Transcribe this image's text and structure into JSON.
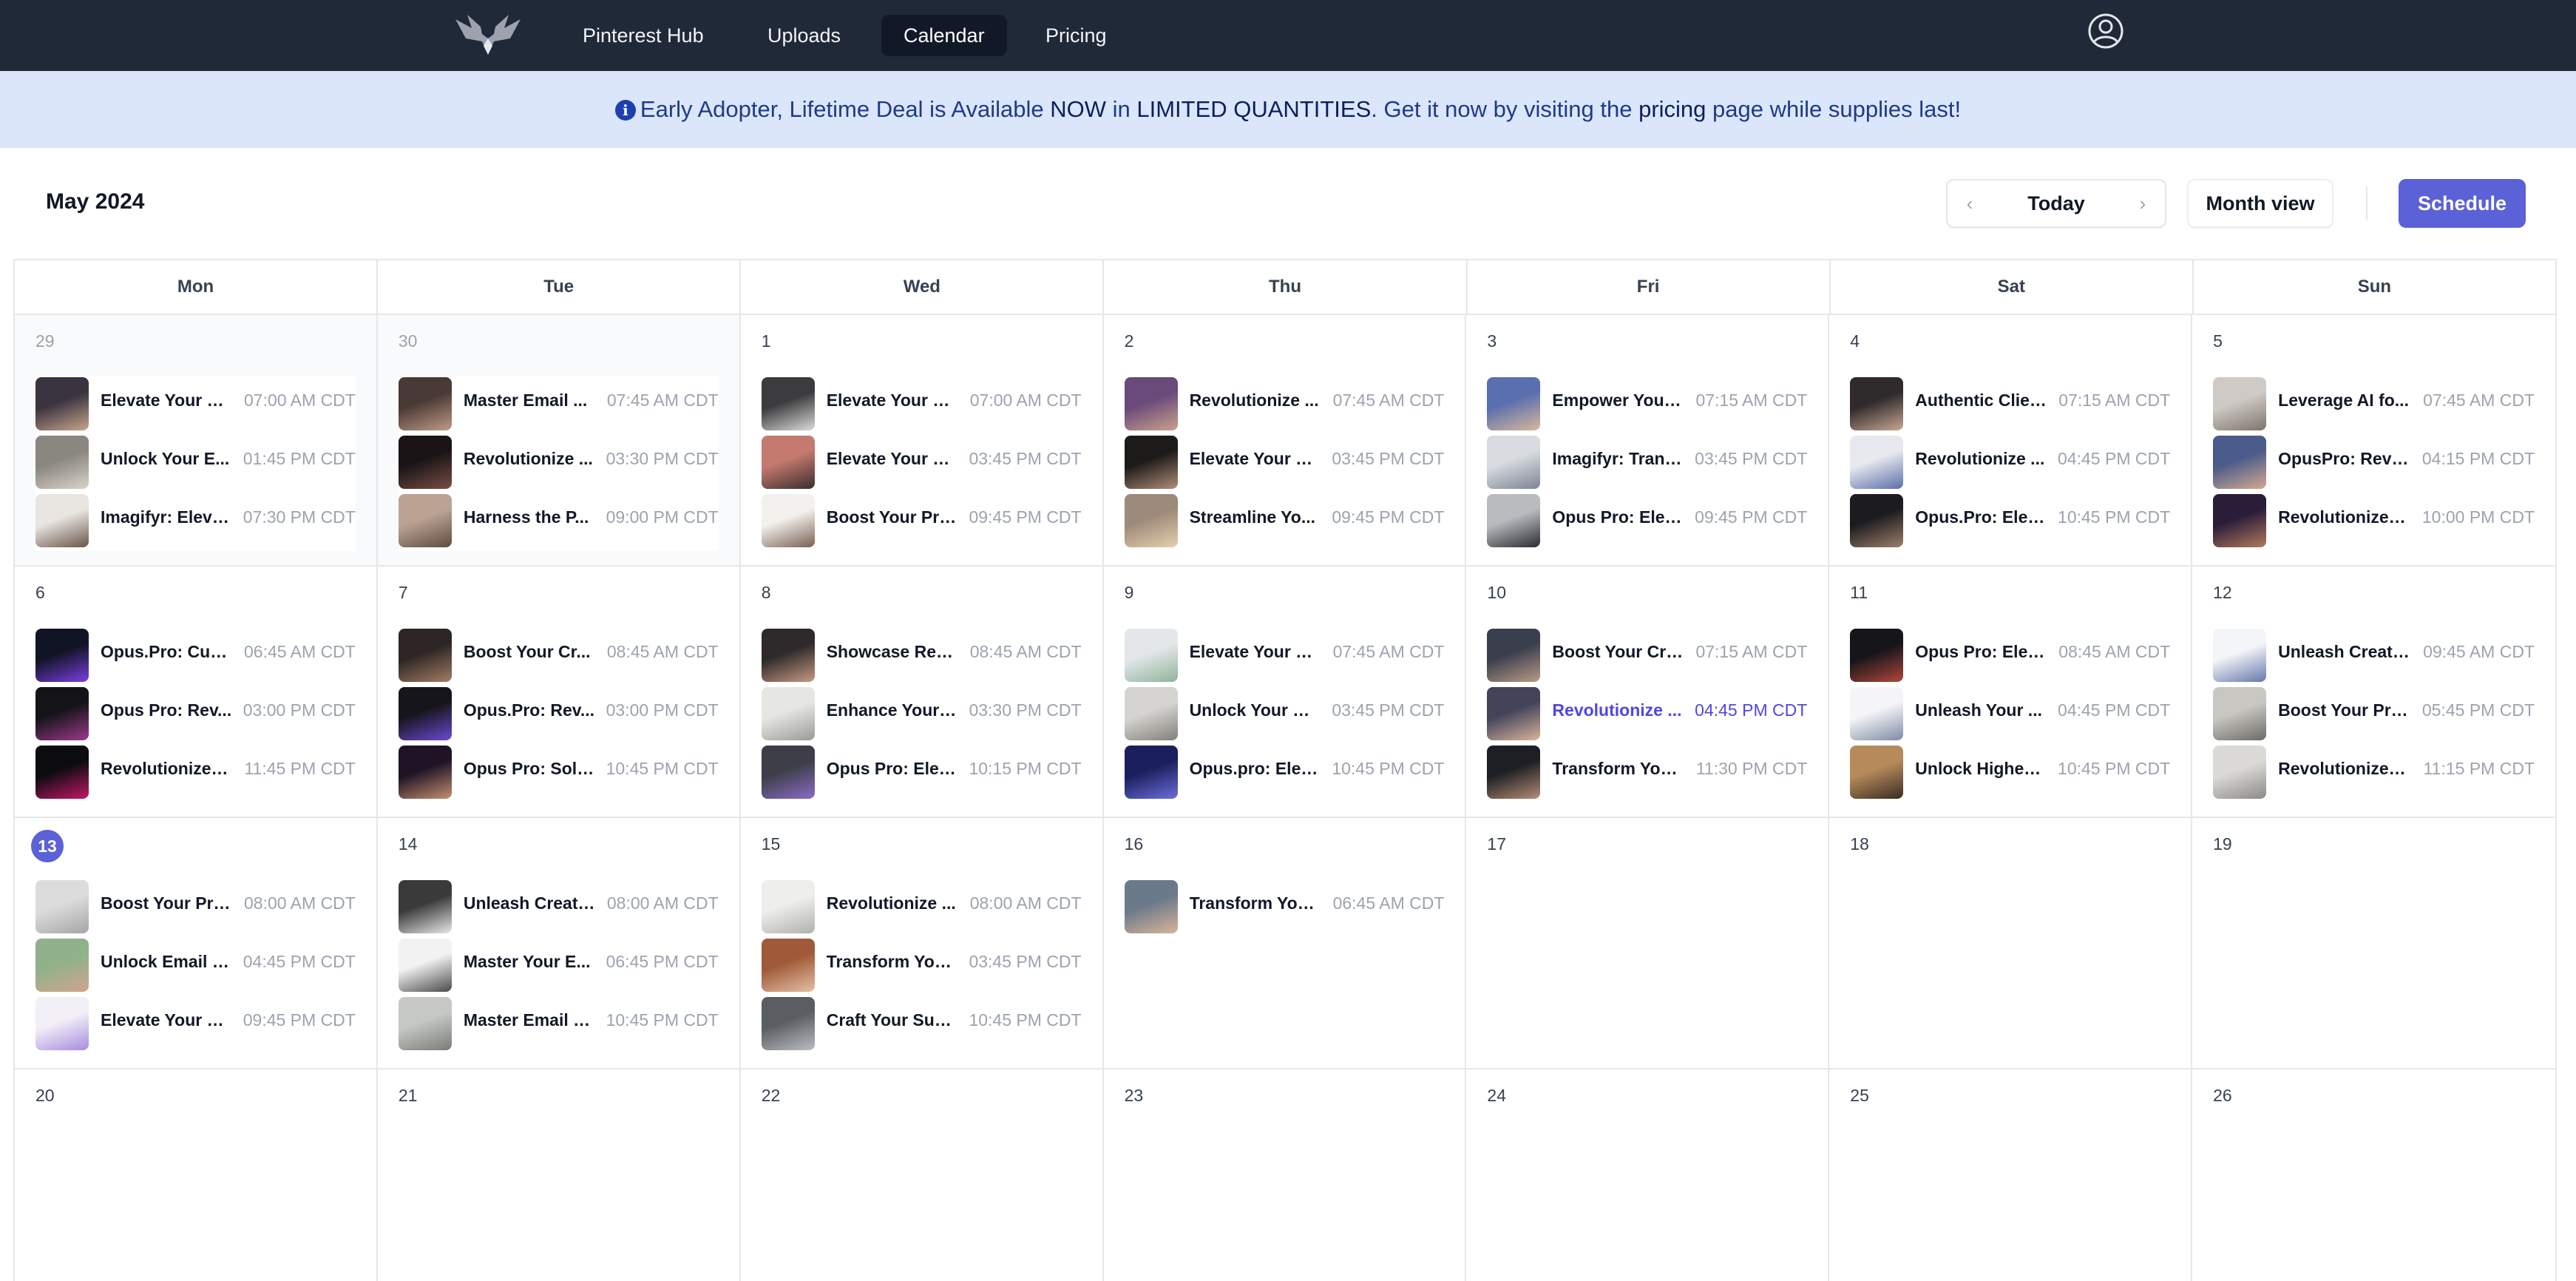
{
  "nav": {
    "links": [
      "Pinterest Hub",
      "Uploads",
      "Calendar",
      "Pricing"
    ],
    "active": "Calendar"
  },
  "banner": {
    "part1": "Early Adopter, Lifetime Deal is Available ",
    "now": "NOW",
    "part2": " in ",
    "limited": "LIMITED QUANTITIES",
    "part3": ". Get it now by visiting the ",
    "pricing": "pricing",
    "part4": " page while supplies last!"
  },
  "header": {
    "month": "May 2024",
    "today_label": "Today",
    "view_label": "Month view",
    "schedule_label": "Schedule"
  },
  "weekdays": [
    "Mon",
    "Tue",
    "Wed",
    "Thu",
    "Fri",
    "Sat",
    "Sun"
  ],
  "colors": {
    "accent": "#5b61d6",
    "nav_bg": "#1f2937",
    "banner_bg": "#dbe6fb",
    "highlight_event": "#4f46e5"
  },
  "days": [
    {
      "num": "29",
      "prev": true,
      "events": [
        {
          "title": "Elevate Your B...",
          "time": "07:00 AM CDT",
          "thumb": [
            "#3a3340",
            "#c8a58a"
          ]
        },
        {
          "title": "Unlock Your E...",
          "time": "01:45 PM CDT",
          "thumb": [
            "#8a8680",
            "#d9d4cc"
          ]
        },
        {
          "title": "Imagifyr: Eleva...",
          "time": "07:30 PM CDT",
          "thumb": [
            "#e9e6e2",
            "#6b5347"
          ]
        }
      ]
    },
    {
      "num": "30",
      "prev": true,
      "events": [
        {
          "title": "Master Email ...",
          "time": "07:45 AM CDT",
          "thumb": [
            "#4a3a36",
            "#c19a86"
          ]
        },
        {
          "title": "Revolutionize ...",
          "time": "03:30 PM CDT",
          "thumb": [
            "#1a1416",
            "#7a4d46"
          ]
        },
        {
          "title": "Harness the P...",
          "time": "09:00 PM CDT",
          "thumb": [
            "#bba394",
            "#5e4b40"
          ]
        }
      ]
    },
    {
      "num": "1",
      "events": [
        {
          "title": "Elevate Your E...",
          "time": "07:00 AM CDT",
          "thumb": [
            "#3c3c3e",
            "#dcdcdc"
          ]
        },
        {
          "title": "Elevate Your E...",
          "time": "03:45 PM CDT",
          "thumb": [
            "#c47a6e",
            "#3b2c2c"
          ]
        },
        {
          "title": "Boost Your Pro...",
          "time": "09:45 PM CDT",
          "thumb": [
            "#f3f1ee",
            "#7a5f52"
          ]
        }
      ]
    },
    {
      "num": "2",
      "events": [
        {
          "title": "Revolutionize ...",
          "time": "07:45 AM CDT",
          "thumb": [
            "#6a4a7a",
            "#caa18b"
          ]
        },
        {
          "title": "Elevate Your B...",
          "time": "03:45 PM CDT",
          "thumb": [
            "#1d1a1a",
            "#b08e78"
          ]
        },
        {
          "title": "Streamline Yo...",
          "time": "09:45 PM CDT",
          "thumb": [
            "#9d8a7a",
            "#e6cfae"
          ]
        }
      ]
    },
    {
      "num": "3",
      "events": [
        {
          "title": "Empower Your ...",
          "time": "07:15 AM CDT",
          "thumb": [
            "#5a6fb0",
            "#d9b79a"
          ]
        },
        {
          "title": "Imagifyr: Trans...",
          "time": "03:45 PM CDT",
          "thumb": [
            "#d8dbe0",
            "#7b8494"
          ]
        },
        {
          "title": "Opus Pro: Elev...",
          "time": "09:45 PM CDT",
          "thumb": [
            "#b9bbbf",
            "#2a2c33"
          ]
        }
      ]
    },
    {
      "num": "4",
      "events": [
        {
          "title": "Authentic Clien...",
          "time": "07:15 AM CDT",
          "thumb": [
            "#2f2a2c",
            "#c9a891"
          ]
        },
        {
          "title": "Revolutionize ...",
          "time": "04:45 PM CDT",
          "thumb": [
            "#e8e9ee",
            "#5a6ea8"
          ]
        },
        {
          "title": "Opus.Pro: Elev...",
          "time": "10:45 PM CDT",
          "thumb": [
            "#1c1c20",
            "#a07e6a"
          ]
        }
      ]
    },
    {
      "num": "5",
      "events": [
        {
          "title": "Leverage AI fo...",
          "time": "07:45 AM CDT",
          "thumb": [
            "#cfcac5",
            "#7d746b"
          ]
        },
        {
          "title": "OpusPro: Revol...",
          "time": "04:15 PM CDT",
          "thumb": [
            "#4a5b8c",
            "#d3a98e"
          ]
        },
        {
          "title": "Revolutionize Y...",
          "time": "10:00 PM CDT",
          "thumb": [
            "#2a1d3a",
            "#b27a5c"
          ]
        }
      ]
    },
    {
      "num": "6",
      "events": [
        {
          "title": "Opus.Pro: Cutt...",
          "time": "06:45 AM CDT",
          "thumb": [
            "#101425",
            "#7a3ee0"
          ]
        },
        {
          "title": "Opus Pro: Rev...",
          "time": "03:00 PM CDT",
          "thumb": [
            "#141418",
            "#9b3b8a"
          ]
        },
        {
          "title": "Revolutionize Y...",
          "time": "11:45 PM CDT",
          "thumb": [
            "#0c0c0f",
            "#c2186a"
          ]
        }
      ]
    },
    {
      "num": "7",
      "events": [
        {
          "title": "Boost Your Cr...",
          "time": "08:45 AM CDT",
          "thumb": [
            "#2d2624",
            "#a47c66"
          ]
        },
        {
          "title": "Opus.Pro: Rev...",
          "time": "03:00 PM CDT",
          "thumb": [
            "#17151c",
            "#6c4ad4"
          ]
        },
        {
          "title": "Opus Pro: Solu...",
          "time": "10:45 PM CDT",
          "thumb": [
            "#1e1426",
            "#c59070"
          ]
        }
      ]
    },
    {
      "num": "8",
      "events": [
        {
          "title": "Showcase Rea...",
          "time": "08:45 AM CDT",
          "thumb": [
            "#2e2a2b",
            "#c89a82"
          ]
        },
        {
          "title": "Enhance Your ...",
          "time": "03:30 PM CDT",
          "thumb": [
            "#e6e6e3",
            "#9a9a95"
          ]
        },
        {
          "title": "Opus Pro: Elev...",
          "time": "10:15 PM CDT",
          "thumb": [
            "#3d3e47",
            "#8a6cc8"
          ]
        }
      ]
    },
    {
      "num": "9",
      "events": [
        {
          "title": "Elevate Your B...",
          "time": "07:45 AM CDT",
          "thumb": [
            "#e4e7ea",
            "#8fb39a"
          ]
        },
        {
          "title": "Unlock Your W...",
          "time": "03:45 PM CDT",
          "thumb": [
            "#d5d4d0",
            "#83807a"
          ]
        },
        {
          "title": "Opus.pro: Elev...",
          "time": "10:45 PM CDT",
          "thumb": [
            "#1b1f5e",
            "#6b6ed8"
          ]
        }
      ]
    },
    {
      "num": "10",
      "events": [
        {
          "title": "Boost Your Cre...",
          "time": "07:15 AM CDT",
          "thumb": [
            "#3a3f4e",
            "#b99a86"
          ]
        },
        {
          "title": "Revolutionize ...",
          "time": "04:45 PM CDT",
          "highlight": true,
          "thumb": [
            "#43445a",
            "#d8b49b"
          ]
        },
        {
          "title": "Transform Your...",
          "time": "11:30 PM CDT",
          "thumb": [
            "#1e1f24",
            "#b58d76"
          ]
        }
      ]
    },
    {
      "num": "11",
      "events": [
        {
          "title": "Opus Pro: Elev...",
          "time": "08:45 AM CDT",
          "thumb": [
            "#15151a",
            "#b0463a"
          ]
        },
        {
          "title": "Unleash Your ...",
          "time": "04:45 PM CDT",
          "thumb": [
            "#f5f5f7",
            "#7f8aa6"
          ]
        },
        {
          "title": "Unlock Higher ...",
          "time": "10:45 PM CDT",
          "thumb": [
            "#b68a5a",
            "#3a2c22"
          ]
        }
      ]
    },
    {
      "num": "12",
      "events": [
        {
          "title": "Unleash Creati...",
          "time": "09:45 AM CDT",
          "thumb": [
            "#f4f5f8",
            "#6677aa"
          ]
        },
        {
          "title": "Boost Your Pro...",
          "time": "05:45 PM CDT",
          "thumb": [
            "#c9c7c2",
            "#6c6a66"
          ]
        },
        {
          "title": "Revolutionize Y...",
          "time": "11:15 PM CDT",
          "thumb": [
            "#dcdad6",
            "#8c8a86"
          ]
        }
      ]
    },
    {
      "num": "13",
      "today": true,
      "events": [
        {
          "title": "Boost Your Pro...",
          "time": "08:00 AM CDT",
          "thumb": [
            "#dcdcdc",
            "#a6a6a6"
          ]
        },
        {
          "title": "Unlock Email S...",
          "time": "04:45 PM CDT",
          "thumb": [
            "#8fb28a",
            "#cfa58e"
          ]
        },
        {
          "title": "Elevate Your E...",
          "time": "09:45 PM CDT",
          "thumb": [
            "#f2f0f6",
            "#a88be0"
          ]
        }
      ]
    },
    {
      "num": "14",
      "events": [
        {
          "title": "Unleash Creati...",
          "time": "08:00 AM CDT",
          "thumb": [
            "#3a3a3a",
            "#e8e8e8"
          ]
        },
        {
          "title": "Master Your E...",
          "time": "06:45 PM CDT",
          "thumb": [
            "#f2f2f2",
            "#4a4a4a"
          ]
        },
        {
          "title": "Master Email M...",
          "time": "10:45 PM CDT",
          "thumb": [
            "#c6c8c4",
            "#7a7c78"
          ]
        }
      ]
    },
    {
      "num": "15",
      "events": [
        {
          "title": "Revolutionize ...",
          "time": "08:00 AM CDT",
          "thumb": [
            "#eeeeec",
            "#b0b0ac"
          ]
        },
        {
          "title": "Transform You...",
          "time": "03:45 PM CDT",
          "thumb": [
            "#a05a3a",
            "#e4c0a4"
          ]
        },
        {
          "title": "Craft Your Suc...",
          "time": "10:45 PM CDT",
          "thumb": [
            "#5a5e62",
            "#babec2"
          ]
        }
      ]
    },
    {
      "num": "16",
      "events": [
        {
          "title": "Transform You...",
          "time": "06:45 AM CDT",
          "thumb": [
            "#6b7a8a",
            "#d9b49a"
          ]
        }
      ]
    },
    {
      "num": "17",
      "events": []
    },
    {
      "num": "18",
      "events": []
    },
    {
      "num": "19",
      "events": []
    },
    {
      "num": "20",
      "events": []
    },
    {
      "num": "21",
      "events": []
    },
    {
      "num": "22",
      "events": []
    },
    {
      "num": "23",
      "events": []
    },
    {
      "num": "24",
      "events": []
    },
    {
      "num": "25",
      "events": []
    },
    {
      "num": "26",
      "events": []
    }
  ]
}
